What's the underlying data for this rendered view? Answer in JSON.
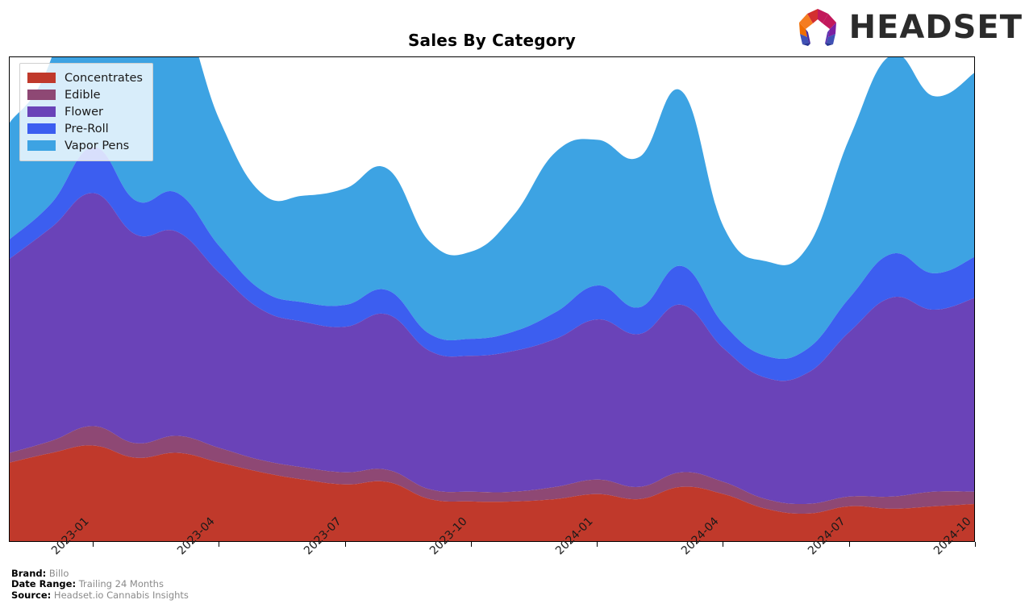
{
  "header": {
    "title": "Sales By Category",
    "logo_word": "HEADSET",
    "logo_mark_name": "headset-omega-logo"
  },
  "footnotes": [
    {
      "key": "Brand:",
      "value": "Billo"
    },
    {
      "key": "Date Range:",
      "value": "Trailing 24 Months"
    },
    {
      "key": "Source:",
      "value": "Headset.io Cannabis Insights"
    }
  ],
  "legend": {
    "position": "upper-left",
    "items": [
      {
        "label": "Concentrates",
        "color": "#c0392b"
      },
      {
        "label": "Edible",
        "color": "#8e4874"
      },
      {
        "label": "Flower",
        "color": "#6a43b8"
      },
      {
        "label": "Pre-Roll",
        "color": "#3c5ef0"
      },
      {
        "label": "Vapor Pens",
        "color": "#3da3e3"
      }
    ]
  },
  "chart_data": {
    "type": "area",
    "stacked": true,
    "title": "Sales By Category",
    "xlabel": "",
    "ylabel": "",
    "grid": false,
    "legend_position": "upper left",
    "x": [
      "2022-11",
      "2022-12",
      "2023-01",
      "2023-02",
      "2023-03",
      "2023-04",
      "2023-05",
      "2023-06",
      "2023-07",
      "2023-08",
      "2023-09",
      "2023-10",
      "2023-11",
      "2023-12",
      "2024-01",
      "2024-02",
      "2024-03",
      "2024-04",
      "2024-05",
      "2024-06",
      "2024-07",
      "2024-08",
      "2024-09",
      "2024-10"
    ],
    "tick_labels": [
      "2023-01",
      "2023-04",
      "2023-07",
      "2023-10",
      "2024-01",
      "2024-04",
      "2024-07",
      "2024-10"
    ],
    "ylim": [
      0,
      100
    ],
    "series": [
      {
        "name": "Concentrates",
        "color": "#c0392b",
        "values": [
          16.5,
          18.5,
          20.0,
          17.5,
          18.5,
          16.5,
          14.5,
          13.0,
          12.0,
          12.5,
          9.0,
          8.5,
          8.5,
          9.0,
          10.0,
          9.0,
          11.5,
          10.0,
          7.0,
          6.0,
          7.5,
          7.0,
          7.5,
          8.0
        ]
      },
      {
        "name": "Edible",
        "color": "#8e4874",
        "values": [
          2.0,
          2.5,
          4.0,
          3.0,
          3.5,
          3.0,
          2.5,
          2.5,
          2.5,
          2.5,
          2.0,
          2.0,
          2.0,
          2.5,
          3.0,
          2.5,
          3.0,
          2.5,
          2.0,
          2.0,
          2.0,
          2.5,
          3.0,
          2.5
        ]
      },
      {
        "name": "Flower",
        "color": "#6a43b8",
        "values": [
          40.0,
          44.0,
          48.0,
          43.0,
          42.0,
          36.0,
          31.0,
          30.0,
          30.0,
          32.0,
          28.5,
          28.0,
          29.0,
          30.5,
          33.0,
          31.5,
          34.5,
          27.5,
          25.0,
          27.0,
          34.0,
          41.0,
          37.5,
          40.0
        ]
      },
      {
        "name": "Pre-Roll",
        "color": "#3c5ef0",
        "values": [
          4.0,
          5.0,
          9.5,
          7.0,
          8.0,
          5.5,
          4.0,
          4.0,
          4.5,
          5.0,
          3.5,
          3.5,
          4.0,
          5.5,
          7.0,
          5.5,
          8.0,
          5.0,
          4.5,
          5.0,
          7.0,
          9.0,
          7.5,
          8.5
        ]
      },
      {
        "name": "Vapor Pens",
        "color": "#3da3e3",
        "values": [
          24.0,
          30.0,
          55.0,
          33.0,
          38.0,
          26.0,
          20.0,
          22.0,
          24.0,
          25.0,
          19.0,
          18.0,
          24.0,
          33.0,
          30.0,
          31.0,
          36.0,
          20.0,
          19.5,
          21.0,
          33.0,
          41.0,
          36.5,
          38.0
        ]
      }
    ]
  }
}
